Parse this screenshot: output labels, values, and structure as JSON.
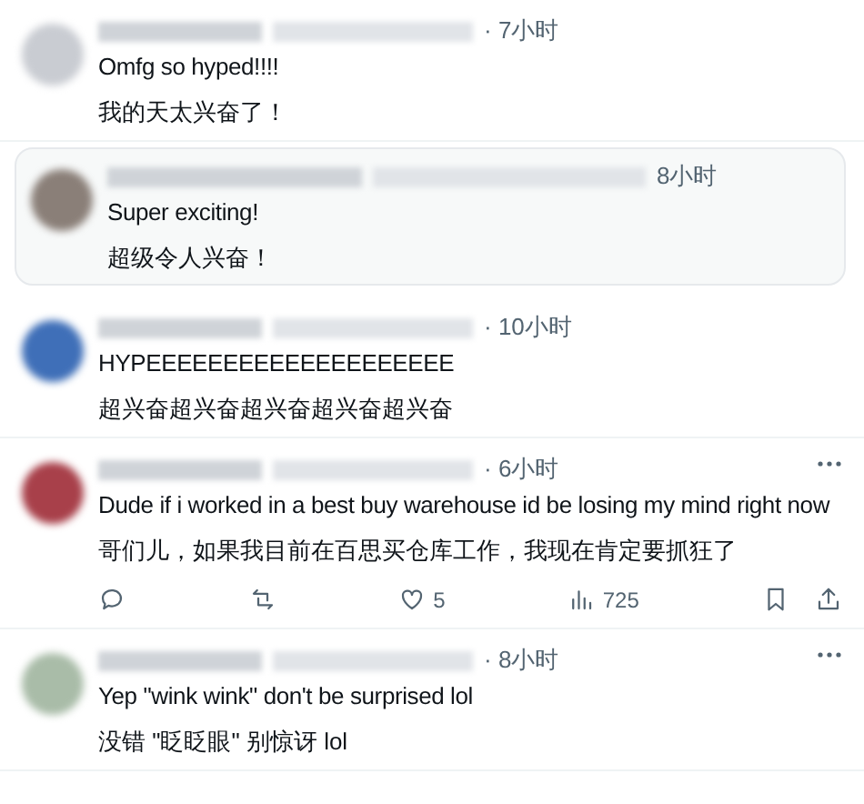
{
  "comments": [
    {
      "kind": "reply",
      "time": "· 7小时",
      "text": "Omfg so hyped!!!!",
      "translation": "我的天太兴奋了！",
      "more": false
    },
    {
      "kind": "quote",
      "time": "8小时",
      "text": "Super exciting!",
      "translation": "超级令人兴奋！",
      "more": false
    },
    {
      "kind": "reply",
      "time": "· 10小时",
      "text": "HYPEEEEEEEEEEEEEEEEEEEE",
      "translation": "超兴奋超兴奋超兴奋超兴奋超兴奋",
      "more": false
    },
    {
      "kind": "reply",
      "time": "· 6小时",
      "text": "Dude if i worked in a best buy warehouse id be losing my mind right now",
      "translation": "哥们儿，如果我目前在百思买仓库工作，我现在肯定要抓狂了",
      "more": true,
      "actions": {
        "likes": "5",
        "views": "725"
      }
    },
    {
      "kind": "reply",
      "time": "· 8小时",
      "text": "Yep \"wink wink\" don't be surprised lol",
      "translation": "没错 \"眨眨眼\" 别惊讶 lol",
      "more": true
    }
  ]
}
